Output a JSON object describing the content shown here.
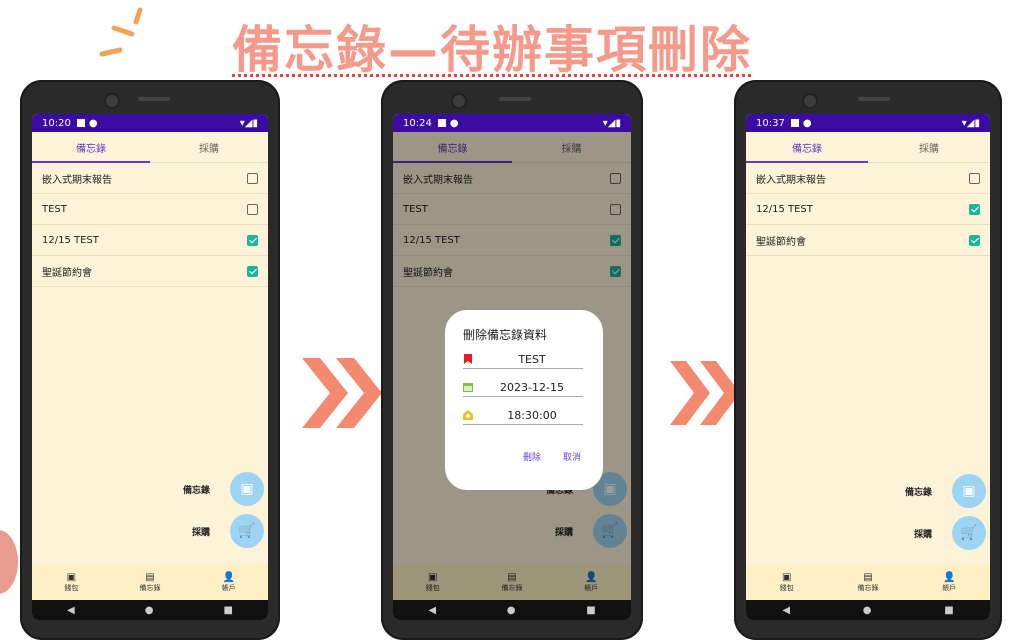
{
  "title": "備忘錄—待辦事項刪除",
  "colors": {
    "accent": "#5b3cc4",
    "status_bar": "#3a0ca3",
    "screen_bg": "#fdf3d8",
    "checked": "#1fb59b",
    "fab": "#9dd4f3",
    "title": "#f59a8a"
  },
  "tabs": [
    "備忘錄",
    "採購"
  ],
  "fab_labels": {
    "memo": "備忘錄",
    "purchase": "採購"
  },
  "bottom_nav": [
    "錢包",
    "備忘錄",
    "帳戶"
  ],
  "screens": [
    {
      "time": "10:20",
      "items": [
        {
          "text": "嵌入式期末報告",
          "checked": false
        },
        {
          "text": "TEST",
          "checked": false
        },
        {
          "text": "12/15 TEST",
          "checked": true
        },
        {
          "text": "聖誕節約會",
          "checked": true
        }
      ]
    },
    {
      "time": "10:24",
      "items": [
        {
          "text": "嵌入式期末報告",
          "checked": false
        },
        {
          "text": "TEST",
          "checked": false
        },
        {
          "text": "12/15 TEST",
          "checked": true
        },
        {
          "text": "聖誕節約會",
          "checked": true
        }
      ],
      "dialog": {
        "title": "刪除備忘錄資料",
        "name": "TEST",
        "date": "2023-12-15",
        "time": "18:30:00",
        "delete_label": "刪除",
        "cancel_label": "取消"
      }
    },
    {
      "time": "10:37",
      "items": [
        {
          "text": "嵌入式期末報告",
          "checked": false
        },
        {
          "text": "12/15 TEST",
          "checked": true
        },
        {
          "text": "聖誕節約會",
          "checked": true
        }
      ]
    }
  ]
}
